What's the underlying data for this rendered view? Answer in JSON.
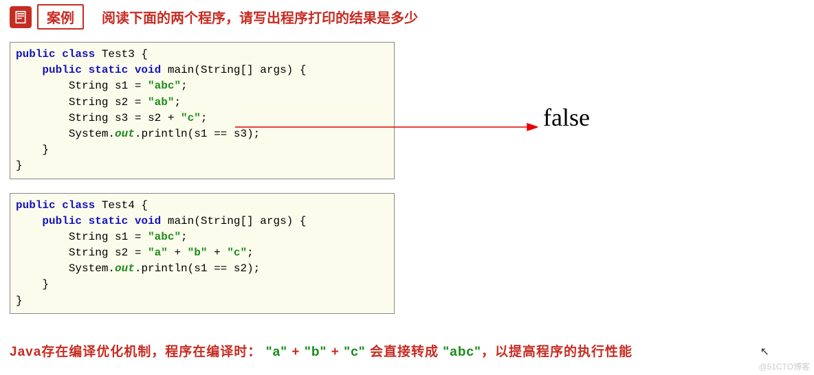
{
  "header": {
    "badge": "案例",
    "title": "阅读下面的两个程序，请写出程序打印的结果是多少"
  },
  "code1": {
    "l1": {
      "a": "public class",
      "b": " Test3 {"
    },
    "l2": {
      "a": "    ",
      "b": "public static void",
      "c": " main(String[] args) {"
    },
    "l3": {
      "a": "        String s1 = ",
      "b": "\"abc\"",
      "c": ";"
    },
    "l4": {
      "a": "        String s2 = ",
      "b": "\"ab\"",
      "c": ";"
    },
    "l5": {
      "a": "        String s3 = s2 + ",
      "b": "\"c\"",
      "c": ";"
    },
    "l6": {
      "a": "        System.",
      "b": "out",
      "c": ".println(s1 == s3);"
    },
    "l7": "    }",
    "l8": "}"
  },
  "code2": {
    "l1": {
      "a": "public class",
      "b": " Test4 {"
    },
    "l2": {
      "a": "    ",
      "b": "public static void",
      "c": " main(String[] args) {"
    },
    "l3": {
      "a": "        String s1 = ",
      "b": "\"abc\"",
      "c": ";"
    },
    "l4": {
      "a": "        String s2 = ",
      "b": "\"a\"",
      "c": " + ",
      "d": "\"b\"",
      "e": " + ",
      "f": "\"c\"",
      "g": ";"
    },
    "l5": {
      "a": "        System.",
      "b": "out",
      "c": ".println(s1 == s2);"
    },
    "l6": "    }",
    "l7": "}"
  },
  "result": "false",
  "footer": {
    "p1": "Java存在编译优化机制，程序在编译时：",
    "p2": "\"a\"",
    "p3": " + ",
    "p4": "\"b\"",
    "p5": " + ",
    "p6": "\"c\"",
    "p7": "  会直接转成  ",
    "p8": "\"abc\"",
    "p9": "，以提高程序的执行性能"
  },
  "watermark": "@51CTO博客"
}
